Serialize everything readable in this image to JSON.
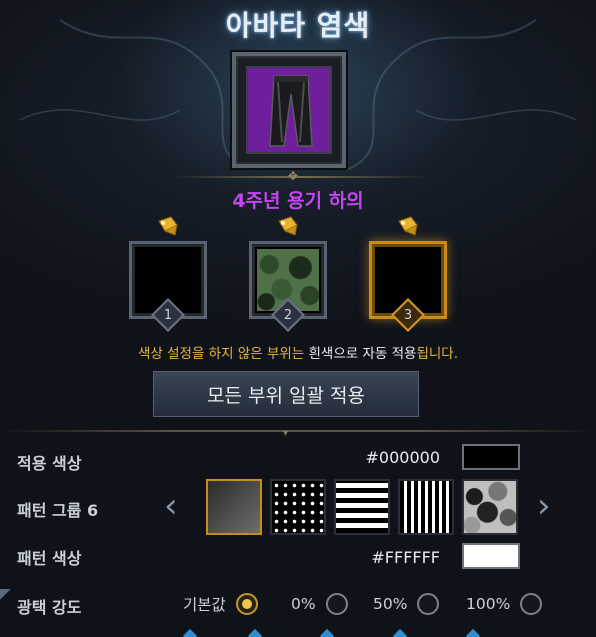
{
  "header": {
    "title": "아바타 염색"
  },
  "item": {
    "name": "4주년 용기 하의",
    "color": "#6f1f9c"
  },
  "slots": [
    {
      "number": "1",
      "state": "empty"
    },
    {
      "number": "2",
      "state": "camo"
    },
    {
      "number": "3",
      "state": "selected"
    }
  ],
  "notice": {
    "part1": "색상 설정을 하지 않은 부위는 ",
    "part2": "흰색",
    "part3": "으로 자동 적용",
    "part4": "됩니다."
  },
  "apply_all": {
    "label": "모든 부위 일괄 적용"
  },
  "apply_color": {
    "label": "적용 색상",
    "hex": "#000000",
    "swatch": "#000000"
  },
  "pattern_group": {
    "label": "패턴 그룹 6",
    "prev_icon": "chevron-left-icon",
    "next_icon": "chevron-right-icon"
  },
  "pattern_color": {
    "label": "패턴 색상",
    "hex": "#FFFFFF",
    "swatch": "#FFFFFF"
  },
  "gloss": {
    "label": "광택 강도",
    "options": [
      {
        "label": "기본값",
        "selected": true
      },
      {
        "label": "0%",
        "selected": false
      },
      {
        "label": "50%",
        "selected": false
      },
      {
        "label": "100%",
        "selected": false
      }
    ]
  },
  "colors": {
    "accent_gold": "#c98c1a",
    "item_purple": "#c346f0",
    "notice_yellow": "#e3b93d"
  }
}
